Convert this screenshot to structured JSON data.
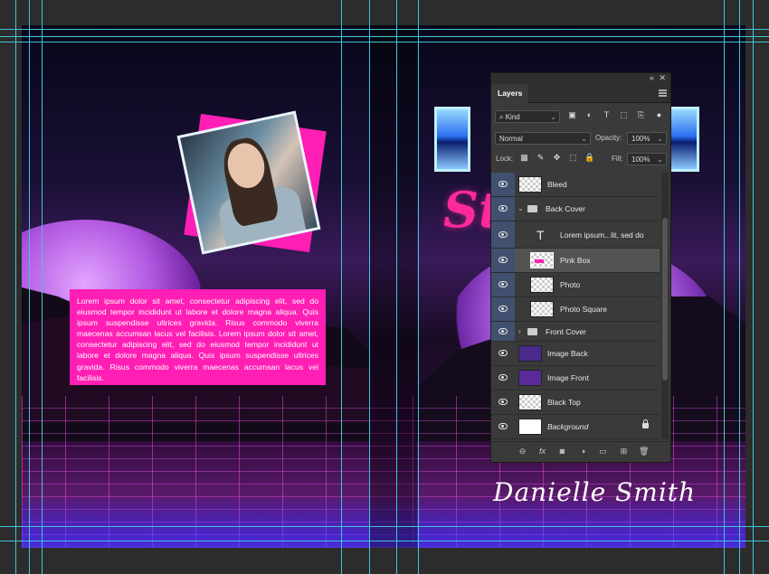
{
  "cover": {
    "back_text": "Lorem ipsum dolor sit amet, consectetur adipiscing elit, sed do eiusmod tempor incididunt ut labore et dolore magna aliqua. Quis ipsum suspendisse ultrices gravida. Risus commodo viverra maecenas accumsan lacus vel facilisis. Lorem ipsum dolor sit amet, consectetur adipiscing elit, sed do eiusmod tempor incididunt ut labore et dolore magna aliqua. Quis ipsum suspendisse ultrices gravida. Risus commodo viverra maecenas accumsan lacus vel facilisis.",
    "author": "Danielle Smith",
    "colors": {
      "pink": "#ff1fb4",
      "guide": "#3fc6d9"
    }
  },
  "panel": {
    "collapse_icon": "«",
    "close_icon": "✕",
    "tab": "Layers",
    "filter": {
      "kind_label": "Kind"
    },
    "blend_mode": "Normal",
    "opacity_label": "Opacity:",
    "opacity_value": "100%",
    "lock_label": "Lock:",
    "fill_label": "Fill:",
    "fill_value": "100%",
    "layers": [
      {
        "name": "Bleed",
        "type": "pixel",
        "indent": 0,
        "selected": false
      },
      {
        "name": "Back Cover",
        "type": "group",
        "indent": 0,
        "expanded": true,
        "selected": false
      },
      {
        "name": "Lorem ipsum...lit, sed do",
        "type": "text",
        "indent": 1,
        "selected": false
      },
      {
        "name": "Pink Box",
        "type": "pixel",
        "indent": 1,
        "selected": true
      },
      {
        "name": "Photo",
        "type": "pixel",
        "indent": 1,
        "selected": false
      },
      {
        "name": "Photo Square",
        "type": "pixel",
        "indent": 1,
        "selected": false
      },
      {
        "name": "Front Cover",
        "type": "group",
        "indent": 0,
        "expanded": false,
        "selected": false
      },
      {
        "name": "Image Back",
        "type": "pixel",
        "indent": 0,
        "selected": false
      },
      {
        "name": "Image Front",
        "type": "pixel",
        "indent": 0,
        "selected": false
      },
      {
        "name": "Black Top",
        "type": "pixel",
        "indent": 0,
        "selected": false
      },
      {
        "name": "Background",
        "type": "background",
        "indent": 0,
        "selected": false,
        "locked": true
      }
    ]
  }
}
